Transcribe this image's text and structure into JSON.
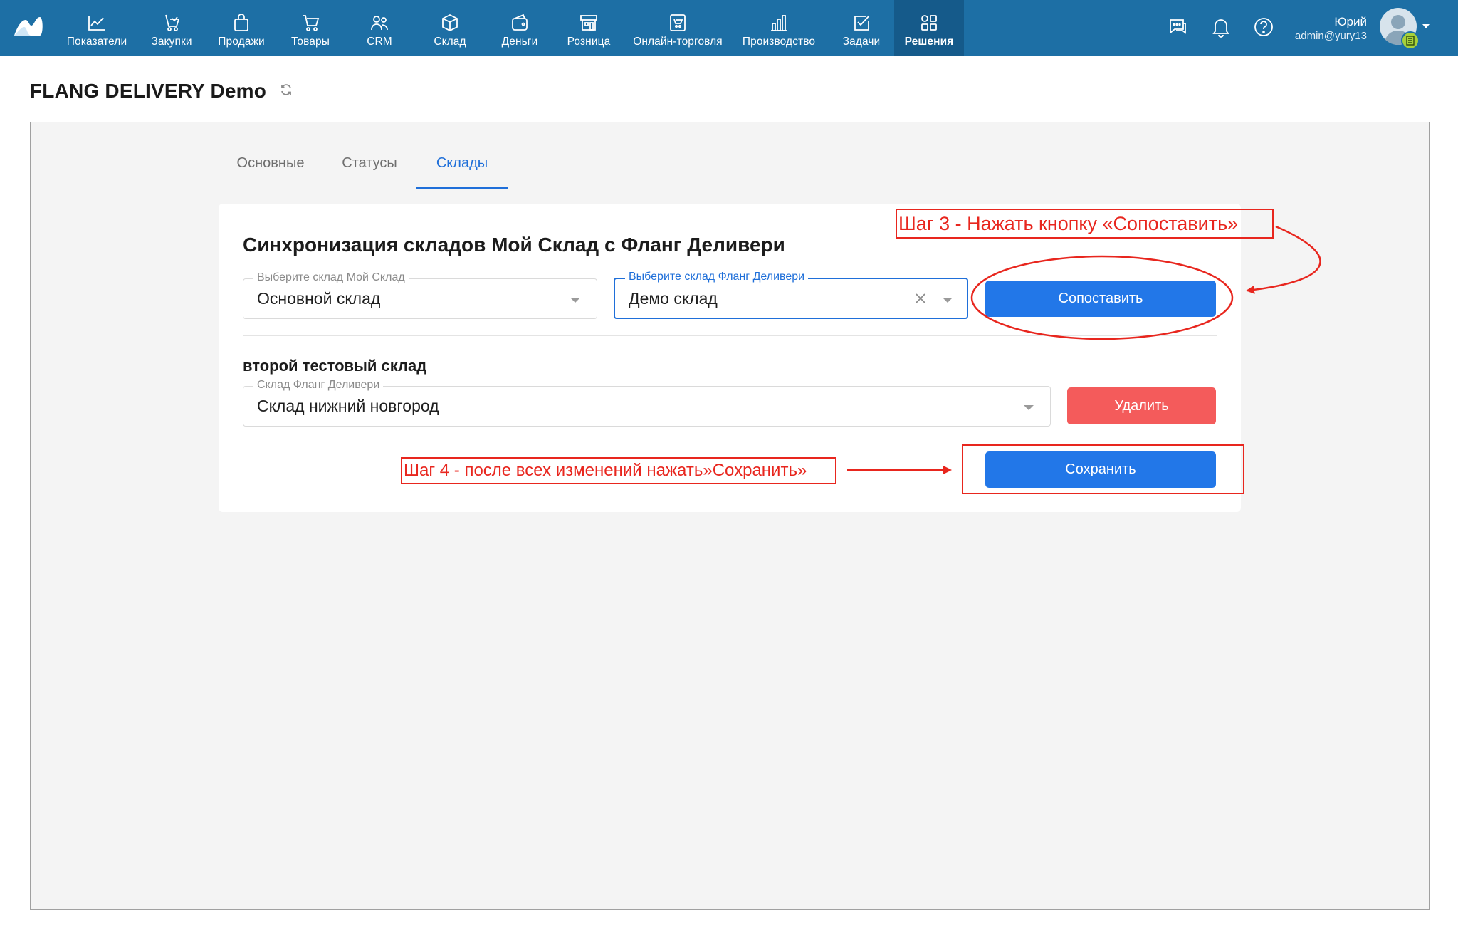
{
  "nav": {
    "items": [
      {
        "label": "Показатели",
        "icon": "chart-line-icon"
      },
      {
        "label": "Закупки",
        "icon": "cart-purchase-icon"
      },
      {
        "label": "Продажи",
        "icon": "shopping-bag-icon"
      },
      {
        "label": "Товары",
        "icon": "shopping-cart-icon"
      },
      {
        "label": "CRM",
        "icon": "users-icon"
      },
      {
        "label": "Склад",
        "icon": "box-icon"
      },
      {
        "label": "Деньги",
        "icon": "wallet-icon"
      },
      {
        "label": "Розница",
        "icon": "store-icon"
      },
      {
        "label": "Онлайн-торговля",
        "icon": "online-store-icon"
      },
      {
        "label": "Производство",
        "icon": "factory-icon"
      },
      {
        "label": "Задачи",
        "icon": "task-check-icon"
      },
      {
        "label": "Решения",
        "icon": "apps-icon",
        "active": true
      }
    ],
    "user": {
      "name": "Юрий",
      "login": "admin@yury13"
    }
  },
  "page": {
    "title": "FLANG DELIVERY Demo"
  },
  "tabs": [
    {
      "label": "Основные"
    },
    {
      "label": "Статусы"
    },
    {
      "label": "Склады",
      "active": true
    }
  ],
  "card": {
    "title": "Синхронизация складов Мой Склад с Фланг Деливери",
    "moysklad_select": {
      "label": "Выберите склад Мой Склад",
      "value": "Основной склад"
    },
    "flang_select": {
      "label": "Выберите склад Фланг Деливери",
      "value": "Демо склад"
    },
    "match_button": "Сопоставить",
    "mapping": {
      "name": "второй тестовый склад",
      "select": {
        "label": "Склад Фланг Деливери",
        "value": "Склад нижний новгород"
      },
      "delete_button": "Удалить"
    },
    "save_button": "Сохранить"
  },
  "annotations": {
    "step3": "Шаг 3 - Нажать кнопку «Сопоставить»",
    "step4": "Шаг 4 - после всех изменений нажать»Сохранить»"
  },
  "colors": {
    "topbar": "#1d6fa5",
    "topbar_active": "#155a8a",
    "accent": "#1f6fd9",
    "primary_button": "#2277e8",
    "danger_button": "#f45b5b",
    "annotation": "#e8261e"
  }
}
